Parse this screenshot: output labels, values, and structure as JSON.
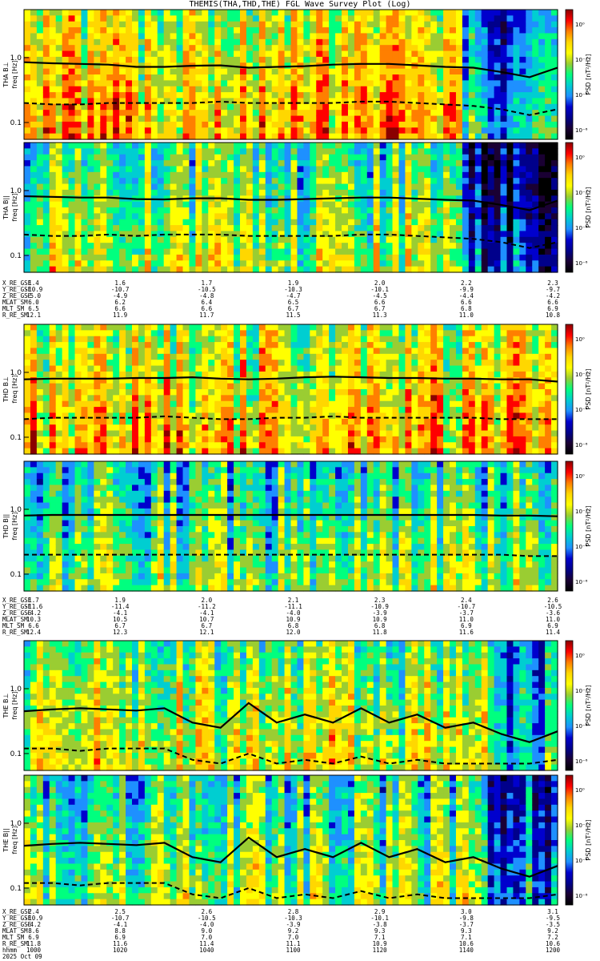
{
  "title": "THEMIS(THA,THD,THE) FGL Wave Survey Plot (Log)",
  "colorbar": {
    "label": "PSD [nT²/Hz]",
    "ticks": [
      "10⁰",
      "10⁻²",
      "10⁻⁴",
      "10⁻⁶"
    ],
    "colors": [
      "#8b0000",
      "#ff0000",
      "#ff7f00",
      "#ffd700",
      "#ffff00",
      "#9acd32",
      "#00ff7f",
      "#00ced1",
      "#1e90ff",
      "#0000cd",
      "#00008b",
      "#1a0033",
      "#000000"
    ]
  },
  "chart_data": {
    "type": "heatmap",
    "ylabel_unit": "freq [Hz]",
    "yscale": "log",
    "ylim": [
      0.055,
      5.5
    ],
    "yticks": [
      "1.0",
      "0.1"
    ],
    "panels": [
      {
        "probe": "THA",
        "component": "THA B⊥",
        "level": 0.72,
        "solid": [
          0.85,
          0.82,
          0.8,
          0.78,
          0.72,
          0.72,
          0.75,
          0.76,
          0.7,
          0.72,
          0.74,
          0.78,
          0.8,
          0.8,
          0.76,
          0.72,
          0.7,
          0.6,
          0.5,
          0.7
        ],
        "dashed": [
          0.2,
          0.19,
          0.19,
          0.2,
          0.2,
          0.2,
          0.2,
          0.21,
          0.2,
          0.2,
          0.2,
          0.2,
          0.21,
          0.21,
          0.2,
          0.19,
          0.18,
          0.16,
          0.13,
          0.16
        ]
      },
      {
        "probe": "THA",
        "component": "THA B||",
        "level": 0.55,
        "solid": [
          0.82,
          0.8,
          0.78,
          0.78,
          0.74,
          0.73,
          0.76,
          0.76,
          0.72,
          0.72,
          0.74,
          0.76,
          0.78,
          0.78,
          0.75,
          0.72,
          0.7,
          0.6,
          0.5,
          0.7
        ],
        "dashed": [
          0.21,
          0.2,
          0.2,
          0.21,
          0.2,
          0.21,
          0.21,
          0.21,
          0.2,
          0.2,
          0.2,
          0.2,
          0.21,
          0.21,
          0.2,
          0.19,
          0.18,
          0.16,
          0.13,
          0.16
        ]
      },
      {
        "probe": "THD",
        "component": "THD B⊥",
        "level": 0.7,
        "solid": [
          0.78,
          0.8,
          0.8,
          0.8,
          0.82,
          0.82,
          0.84,
          0.8,
          0.78,
          0.8,
          0.84,
          0.86,
          0.84,
          0.82,
          0.82,
          0.8,
          0.8,
          0.78,
          0.78,
          0.72
        ],
        "dashed": [
          0.19,
          0.2,
          0.2,
          0.2,
          0.2,
          0.21,
          0.2,
          0.19,
          0.19,
          0.2,
          0.2,
          0.21,
          0.2,
          0.2,
          0.2,
          0.2,
          0.2,
          0.19,
          0.19,
          0.19
        ]
      },
      {
        "probe": "THD",
        "component": "THD B||",
        "level": 0.5,
        "solid": [
          0.8,
          0.82,
          0.82,
          0.82,
          0.82,
          0.82,
          0.82,
          0.82,
          0.82,
          0.82,
          0.82,
          0.82,
          0.82,
          0.82,
          0.82,
          0.82,
          0.82,
          0.8,
          0.8,
          0.78
        ],
        "dashed": [
          0.2,
          0.2,
          0.2,
          0.2,
          0.2,
          0.2,
          0.2,
          0.2,
          0.2,
          0.2,
          0.2,
          0.2,
          0.2,
          0.2,
          0.2,
          0.2,
          0.2,
          0.2,
          0.19,
          0.19
        ]
      },
      {
        "probe": "THE",
        "component": "THE B⊥",
        "level": 0.6,
        "solid": [
          0.45,
          0.48,
          0.5,
          0.48,
          0.46,
          0.5,
          0.3,
          0.25,
          0.6,
          0.3,
          0.4,
          0.3,
          0.5,
          0.3,
          0.4,
          0.25,
          0.3,
          0.2,
          0.15,
          0.22
        ],
        "dashed": [
          0.12,
          0.12,
          0.11,
          0.12,
          0.12,
          0.12,
          0.08,
          0.07,
          0.1,
          0.07,
          0.08,
          0.07,
          0.09,
          0.07,
          0.08,
          0.07,
          0.07,
          0.07,
          0.07,
          0.08
        ]
      },
      {
        "probe": "THE",
        "component": "THE B||",
        "level": 0.52,
        "solid": [
          0.45,
          0.48,
          0.5,
          0.48,
          0.46,
          0.5,
          0.3,
          0.25,
          0.6,
          0.3,
          0.4,
          0.3,
          0.5,
          0.3,
          0.4,
          0.25,
          0.3,
          0.2,
          0.15,
          0.22
        ],
        "dashed": [
          0.12,
          0.12,
          0.11,
          0.12,
          0.12,
          0.12,
          0.08,
          0.07,
          0.1,
          0.07,
          0.08,
          0.07,
          0.09,
          0.07,
          0.08,
          0.07,
          0.07,
          0.07,
          0.07,
          0.08
        ]
      }
    ],
    "ephemeris": [
      {
        "rows": [
          {
            "label": "X_RE_GSE",
            "values": [
              "1.4",
              "1.6",
              "1.7",
              "1.9",
              "2.0",
              "2.2",
              "2.3"
            ]
          },
          {
            "label": "Y_RE_GSE",
            "values": [
              "-10.9",
              "-10.7",
              "-10.5",
              "-10.3",
              "-10.1",
              "-9.9",
              "-9.7"
            ]
          },
          {
            "label": "Z_RE_GSE",
            "values": [
              "-5.0",
              "-4.9",
              "-4.8",
              "-4.7",
              "-4.5",
              "-4.4",
              "-4.2"
            ]
          },
          {
            "label": "MLAT_SM",
            "values": [
              "6.0",
              "6.2",
              "6.4",
              "6.5",
              "6.6",
              "6.6",
              "6.6"
            ]
          },
          {
            "label": "MLT_SM",
            "values": [
              "6.5",
              "6.6",
              "6.6",
              "6.7",
              "6.7",
              "6.8",
              "6.9"
            ]
          },
          {
            "label": "R_RE_SM",
            "values": [
              "12.1",
              "11.9",
              "11.7",
              "11.5",
              "11.3",
              "11.0",
              "10.8"
            ]
          }
        ]
      },
      {
        "rows": [
          {
            "label": "X_RE_GSE",
            "values": [
              "1.7",
              "1.9",
              "2.0",
              "2.1",
              "2.3",
              "2.4",
              "2.6"
            ]
          },
          {
            "label": "Y_RE_GSE",
            "values": [
              "-11.6",
              "-11.4",
              "-11.2",
              "-11.1",
              "-10.9",
              "-10.7",
              "-10.5"
            ]
          },
          {
            "label": "Z_RE_GSE",
            "values": [
              "-4.2",
              "-4.1",
              "-4.1",
              "-4.0",
              "-3.9",
              "-3.7",
              "-3.6"
            ]
          },
          {
            "label": "MLAT_SM",
            "values": [
              "10.3",
              "10.5",
              "10.7",
              "10.9",
              "10.9",
              "11.0",
              "11.0"
            ]
          },
          {
            "label": "MLT_SM",
            "values": [
              "6.6",
              "6.7",
              "6.7",
              "6.8",
              "6.8",
              "6.9",
              "6.9"
            ]
          },
          {
            "label": "R_RE_SM",
            "values": [
              "12.4",
              "12.3",
              "12.1",
              "12.0",
              "11.8",
              "11.6",
              "11.4"
            ]
          }
        ]
      },
      {
        "rows": [
          {
            "label": "X_RE_GSE",
            "values": [
              "2.4",
              "2.5",
              "2.6",
              "2.8",
              "2.9",
              "3.0",
              "3.1"
            ]
          },
          {
            "label": "Y_RE_GSE",
            "values": [
              "-10.9",
              "-10.7",
              "-10.5",
              "-10.3",
              "-10.1",
              "-9.8",
              "-9.5"
            ]
          },
          {
            "label": "Z_RE_GSE",
            "values": [
              "-4.2",
              "-4.1",
              "-4.0",
              "-3.9",
              "-3.8",
              "-3.7",
              "-3.5"
            ]
          },
          {
            "label": "MLAT_SM",
            "values": [
              "8.6",
              "8.8",
              "9.0",
              "9.2",
              "9.3",
              "9.3",
              "9.2"
            ]
          },
          {
            "label": "MLT_SM",
            "values": [
              "6.9",
              "6.9",
              "7.0",
              "7.0",
              "7.1",
              "7.1",
              "7.2"
            ]
          },
          {
            "label": "R_RE_SM",
            "values": [
              "11.8",
              "11.6",
              "11.4",
              "11.1",
              "10.9",
              "10.6",
              "10.6"
            ]
          },
          {
            "label": "hhmm",
            "values": [
              "1000",
              "1020",
              "1040",
              "1100",
              "1120",
              "1140",
              "1200"
            ]
          },
          {
            "label": "2025 Oct 09",
            "values": []
          }
        ]
      }
    ]
  }
}
